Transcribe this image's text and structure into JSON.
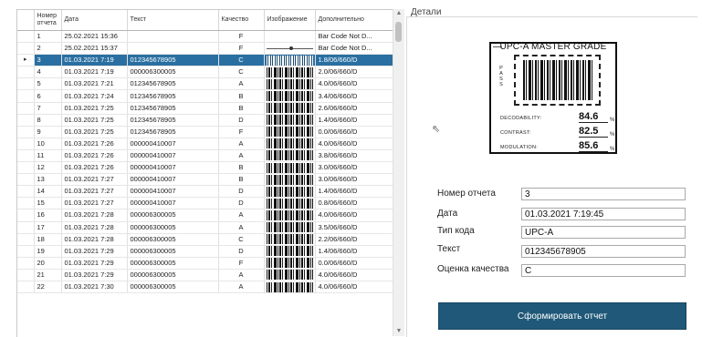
{
  "grid": {
    "columns": [
      "Номер отчета",
      "Дата",
      "Текст",
      "Качество",
      "Изображение",
      "Дополнительно"
    ],
    "selected_row_indicator": "▸",
    "rows": [
      {
        "num": "1",
        "date": "25.02.2021 15:36",
        "text": "",
        "quality": "F",
        "image": "none",
        "extra": "Bar Code Not D..."
      },
      {
        "num": "2",
        "date": "25.02.2021 15:37",
        "text": "",
        "quality": "F",
        "image": "line",
        "extra": "Bar Code Not D..."
      },
      {
        "num": "3",
        "date": "01.03.2021 7:19",
        "text": "012345678905",
        "quality": "C",
        "image": "barcode",
        "extra": "1.8/06/660/D",
        "selected": true
      },
      {
        "num": "4",
        "date": "01.03.2021 7:19",
        "text": "000006300005",
        "quality": "C",
        "image": "barcode",
        "extra": "2.0/06/660/D"
      },
      {
        "num": "5",
        "date": "01.03.2021 7:21",
        "text": "012345678905",
        "quality": "A",
        "image": "barcode",
        "extra": "4.0/06/660/D"
      },
      {
        "num": "6",
        "date": "01.03.2021 7:24",
        "text": "012345678905",
        "quality": "B",
        "image": "barcode",
        "extra": "3.4/06/660/D"
      },
      {
        "num": "7",
        "date": "01.03.2021 7:25",
        "text": "012345678905",
        "quality": "B",
        "image": "barcode",
        "extra": "2.6/06/660/D"
      },
      {
        "num": "8",
        "date": "01.03.2021 7:25",
        "text": "012345678905",
        "quality": "D",
        "image": "barcode",
        "extra": "1.4/06/660/D"
      },
      {
        "num": "9",
        "date": "01.03.2021 7:25",
        "text": "012345678905",
        "quality": "F",
        "image": "barcode",
        "extra": "0.0/06/660/D"
      },
      {
        "num": "10",
        "date": "01.03.2021 7:26",
        "text": "000000410007",
        "quality": "A",
        "image": "barcode",
        "extra": "4.0/06/660/D"
      },
      {
        "num": "11",
        "date": "01.03.2021 7:26",
        "text": "000000410007",
        "quality": "A",
        "image": "barcode",
        "extra": "3.8/06/660/D"
      },
      {
        "num": "12",
        "date": "01.03.2021 7:26",
        "text": "000000410007",
        "quality": "B",
        "image": "barcode",
        "extra": "3.0/06/660/D"
      },
      {
        "num": "13",
        "date": "01.03.2021 7:27",
        "text": "000000410007",
        "quality": "B",
        "image": "barcode",
        "extra": "3.0/06/660/D"
      },
      {
        "num": "14",
        "date": "01.03.2021 7:27",
        "text": "000000410007",
        "quality": "D",
        "image": "barcode",
        "extra": "1.4/06/660/D"
      },
      {
        "num": "15",
        "date": "01.03.2021 7:27",
        "text": "000000410007",
        "quality": "D",
        "image": "barcode",
        "extra": "0.8/06/660/D"
      },
      {
        "num": "16",
        "date": "01.03.2021 7:28",
        "text": "000006300005",
        "quality": "A",
        "image": "barcode",
        "extra": "4.0/06/660/D"
      },
      {
        "num": "17",
        "date": "01.03.2021 7:28",
        "text": "000006300005",
        "quality": "A",
        "image": "barcode",
        "extra": "3.5/06/660/D"
      },
      {
        "num": "18",
        "date": "01.03.2021 7:28",
        "text": "000006300005",
        "quality": "C",
        "image": "barcode",
        "extra": "2.2/06/660/D"
      },
      {
        "num": "19",
        "date": "01.03.2021 7:29",
        "text": "000006300005",
        "quality": "D",
        "image": "barcode",
        "extra": "1.4/06/660/D"
      },
      {
        "num": "20",
        "date": "01.03.2021 7:29",
        "text": "000006300005",
        "quality": "F",
        "image": "barcode",
        "extra": "0.0/06/660/D"
      },
      {
        "num": "21",
        "date": "01.03.2021 7:29",
        "text": "000006300005",
        "quality": "A",
        "image": "barcode",
        "extra": "4.0/06/660/D"
      },
      {
        "num": "22",
        "date": "01.03.2021 7:30",
        "text": "000006300005",
        "quality": "A",
        "image": "barcode",
        "extra": "4.0/06/660/D"
      }
    ]
  },
  "details": {
    "title": "Детали",
    "preview": {
      "header": "UPC-A MASTER GRADE",
      "side_label": "PASS",
      "metrics": [
        {
          "label": "DECODABILITY:",
          "value": "84.6",
          "unit": "%"
        },
        {
          "label": "CONTRAST:",
          "value": "82.5",
          "unit": "%"
        },
        {
          "label": "MODULATION:",
          "value": "85.6",
          "unit": "%"
        }
      ]
    },
    "fields": [
      {
        "label": "Номер отчета",
        "value": "3"
      },
      {
        "label": "Дата",
        "value": "01.03.2021 7:19:45"
      },
      {
        "label": "Тип кода",
        "value": "UPC-A"
      },
      {
        "label": "Текст",
        "value": "012345678905"
      },
      {
        "label": "Оценка качества",
        "value": "C"
      }
    ],
    "report_button": "Сформировать отчет"
  },
  "colors": {
    "selection": "#2a6fa1",
    "button": "#1f5878"
  },
  "icons": {
    "scroll_up": "chevron-up-icon",
    "scroll_down": "chevron-down-icon",
    "cursor": "mouse-pointer-icon"
  }
}
